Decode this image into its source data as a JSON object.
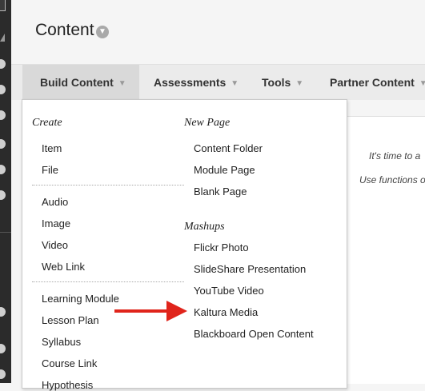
{
  "page": {
    "title": "Content"
  },
  "tabs": [
    {
      "label": "Build Content"
    },
    {
      "label": "Assessments"
    },
    {
      "label": "Tools"
    },
    {
      "label": "Partner Content"
    }
  ],
  "dropdown": {
    "create": {
      "heading": "Create",
      "group1": [
        "Item",
        "File"
      ],
      "group2": [
        "Audio",
        "Image",
        "Video",
        "Web Link"
      ],
      "group3": [
        "Learning Module",
        "Lesson Plan",
        "Syllabus",
        "Course Link",
        "Hypothesis"
      ]
    },
    "new_page": {
      "heading": "New Page",
      "items": [
        "Content Folder",
        "Module Page",
        "Blank Page"
      ]
    },
    "mashups": {
      "heading": "Mashups",
      "items": [
        "Flickr Photo",
        "SlideShare Presentation",
        "YouTube Video",
        "Kaltura Media",
        "Blackboard Open Content"
      ]
    }
  },
  "main": {
    "hint1": "It's time to a",
    "hint2": "Use functions o"
  },
  "colors": {
    "annotation_arrow": "#e0241b",
    "rail": "#2b2b2b"
  }
}
